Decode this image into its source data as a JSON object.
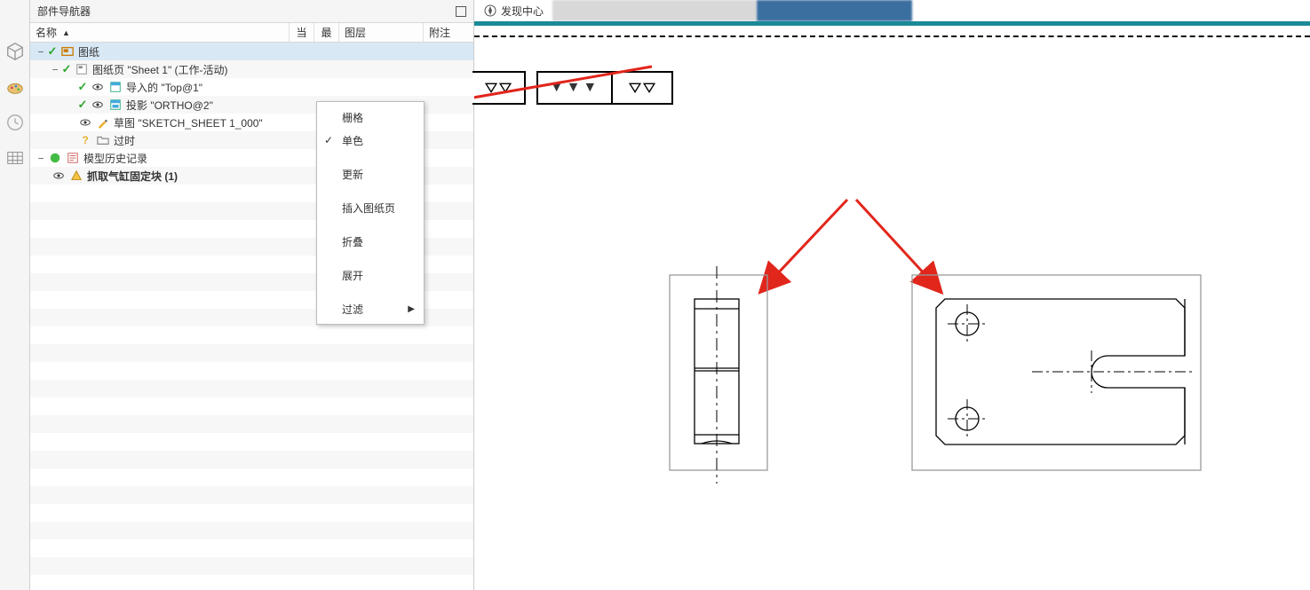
{
  "nav": {
    "title": "部件导航器",
    "columns": {
      "name": "名称",
      "current": "当",
      "recent": "最",
      "layer": "图层",
      "annotation": "附注"
    },
    "tree": {
      "drawing": "图纸",
      "sheet1": "图纸页 \"Sheet 1\" (工作-活动)",
      "imported": "导入的 \"Top@1\"",
      "ortho": "投影 \"ORTHO@2\"",
      "sketch": "草图 \"SKETCH_SHEET 1_000\"",
      "outdated": "过时",
      "history": "模型历史记录",
      "grab_block": "抓取气缸固定块 (1)"
    }
  },
  "ctx": {
    "grid": "栅格",
    "mono": "单色",
    "update": "更新",
    "insert_sheet": "插入图纸页",
    "collapse": "折叠",
    "expand": "展开",
    "filter": "过滤"
  },
  "tabs": {
    "discover": "发现中心"
  }
}
